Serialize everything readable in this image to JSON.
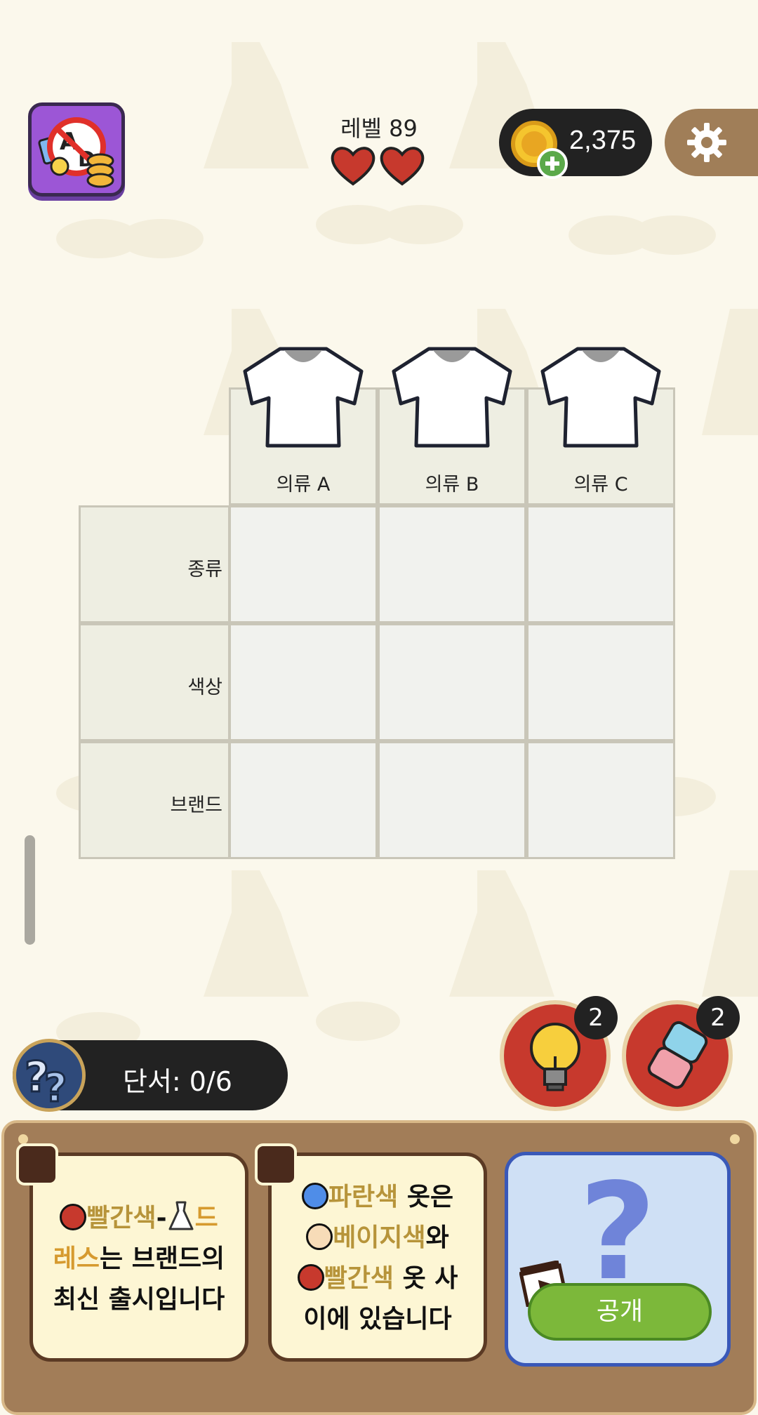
{
  "header": {
    "level_label": "레벨 89",
    "hearts": 2,
    "coins": "2,375"
  },
  "grid": {
    "columns": [
      "의류 A",
      "의류 B",
      "의류 C"
    ],
    "rows": [
      "종류",
      "색상",
      "브랜드"
    ]
  },
  "clue_counter": {
    "label": "단서: 0/6"
  },
  "power_ups": {
    "hint_count": "2",
    "eraser_count": "2"
  },
  "clues": {
    "clue1": {
      "part1": "빨간색",
      "part2": "-",
      "part3": "드",
      "part4": "레스",
      "part5": "는 브랜드의",
      "part6": "최신 출시입니다"
    },
    "clue2": {
      "part1": "파란색",
      "part2": " 옷은",
      "part3": "베이지색",
      "part4": "와",
      "part5": "빨간색",
      "part6": " 옷 사",
      "part7": "이에 있습니다"
    }
  },
  "reveal": {
    "button_label": "공개"
  },
  "colors": {
    "red": "#c7392d",
    "blue": "#4f8de8",
    "beige": "#f7dcb8"
  }
}
